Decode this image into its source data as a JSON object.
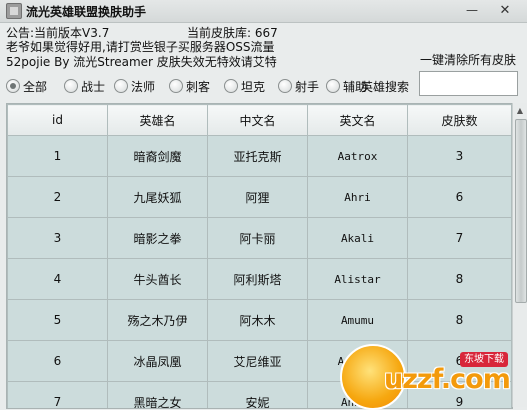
{
  "window": {
    "title": "流光英雄联盟换肤助手",
    "minimize_glyph": "—",
    "close_glyph": "✕"
  },
  "info": {
    "line1_left": "公告:当前版本V3.7",
    "line1_right": "当前皮肤库: 667",
    "line2": "老爷如果觉得好用,请打赏些银子买服务器OSS流量",
    "line3": "52pojie By 流光Streamer 皮肤失效无特效请艾特"
  },
  "actions": {
    "clear_all": "一键清除所有皮肤"
  },
  "filters": [
    {
      "label": "全部",
      "checked": true
    },
    {
      "label": "战士",
      "checked": false
    },
    {
      "label": "法师",
      "checked": false
    },
    {
      "label": "刺客",
      "checked": false
    },
    {
      "label": "坦克",
      "checked": false
    },
    {
      "label": "射手",
      "checked": false
    },
    {
      "label": "辅助",
      "checked": false
    }
  ],
  "search": {
    "label": "英雄搜索",
    "value": ""
  },
  "table": {
    "columns": [
      "id",
      "英雄名",
      "中文名",
      "英文名",
      "皮肤数"
    ],
    "rows": [
      [
        "1",
        "暗裔剑魔",
        "亚托克斯",
        "Aatrox",
        "3"
      ],
      [
        "2",
        "九尾妖狐",
        "阿狸",
        "Ahri",
        "6"
      ],
      [
        "3",
        "暗影之拳",
        "阿卡丽",
        "Akali",
        "7"
      ],
      [
        "4",
        "牛头酋长",
        "阿利斯塔",
        "Alistar",
        "8"
      ],
      [
        "5",
        "殇之木乃伊",
        "阿木木",
        "Amumu",
        "8"
      ],
      [
        "6",
        "冰晶凤凰",
        "艾尼维亚",
        "Anivia",
        "6"
      ],
      [
        "7",
        "黑暗之女",
        "安妮",
        "Annie",
        "9"
      ]
    ]
  },
  "watermark": {
    "text": "uzzf.com",
    "badge": "东坡下载"
  }
}
